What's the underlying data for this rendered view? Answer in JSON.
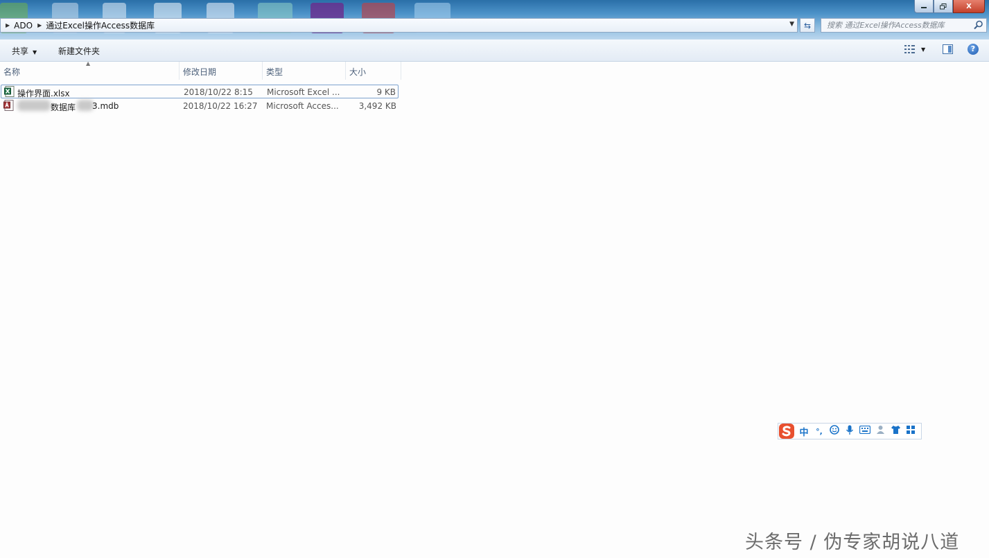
{
  "address_bar": {
    "breadcrumbs": [
      "ADO",
      "通过Excel操作Access数据库"
    ]
  },
  "search": {
    "placeholder": "搜索 通过Excel操作Access数据库"
  },
  "window_controls": {
    "minimize_icon": "minimize-icon",
    "restore_icon": "restore-icon",
    "close_label": "X"
  },
  "command_bar": {
    "share_label": "共享",
    "new_folder_label": "新建文件夹",
    "view_icon": "details-view-icon",
    "preview_icon": "preview-pane-icon",
    "help_label": "?"
  },
  "columns": {
    "name": "名称",
    "date": "修改日期",
    "type": "类型",
    "size": "大小"
  },
  "files": [
    {
      "name": "操作界面.xlsx",
      "date": "2018/10/22 8:15",
      "type": "Microsoft Excel ...",
      "size": "9 KB",
      "icon": "excel-file-icon"
    },
    {
      "name": "数据库",
      "name_suffix": "3.mdb",
      "date": "2018/10/22 16:27",
      "type": "Microsoft Acces...",
      "size": "3,492 KB",
      "icon": "access-file-icon"
    }
  ],
  "ime_toolbar": {
    "mode": "中",
    "punct": "°,",
    "icons": [
      "emoji-icon",
      "microphone-icon",
      "keyboard-icon",
      "user-icon",
      "skin-icon",
      "toolbox-icon"
    ]
  },
  "watermark": "头条号 / 伪专家胡说八道",
  "colors": {
    "accent": "#1a73c9",
    "ime_logo": "#e8502f",
    "header_text": "#4c607a"
  }
}
